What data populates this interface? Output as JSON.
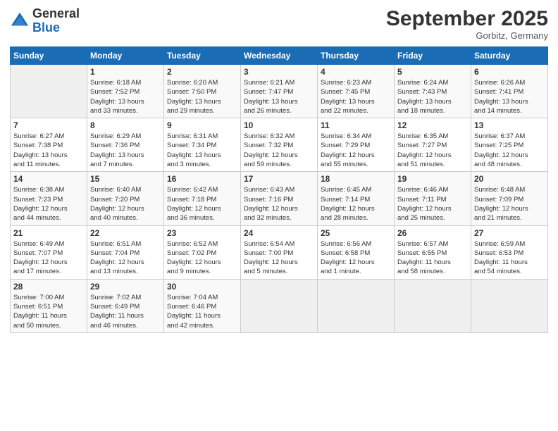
{
  "logo": {
    "general": "General",
    "blue": "Blue"
  },
  "title": "September 2025",
  "location": "Gorbitz, Germany",
  "weekdays": [
    "Sunday",
    "Monday",
    "Tuesday",
    "Wednesday",
    "Thursday",
    "Friday",
    "Saturday"
  ],
  "weeks": [
    [
      {
        "day": "",
        "info": ""
      },
      {
        "day": "1",
        "info": "Sunrise: 6:18 AM\nSunset: 7:52 PM\nDaylight: 13 hours\nand 33 minutes."
      },
      {
        "day": "2",
        "info": "Sunrise: 6:20 AM\nSunset: 7:50 PM\nDaylight: 13 hours\nand 29 minutes."
      },
      {
        "day": "3",
        "info": "Sunrise: 6:21 AM\nSunset: 7:47 PM\nDaylight: 13 hours\nand 26 minutes."
      },
      {
        "day": "4",
        "info": "Sunrise: 6:23 AM\nSunset: 7:45 PM\nDaylight: 13 hours\nand 22 minutes."
      },
      {
        "day": "5",
        "info": "Sunrise: 6:24 AM\nSunset: 7:43 PM\nDaylight: 13 hours\nand 18 minutes."
      },
      {
        "day": "6",
        "info": "Sunrise: 6:26 AM\nSunset: 7:41 PM\nDaylight: 13 hours\nand 14 minutes."
      }
    ],
    [
      {
        "day": "7",
        "info": "Sunrise: 6:27 AM\nSunset: 7:38 PM\nDaylight: 13 hours\nand 11 minutes."
      },
      {
        "day": "8",
        "info": "Sunrise: 6:29 AM\nSunset: 7:36 PM\nDaylight: 13 hours\nand 7 minutes."
      },
      {
        "day": "9",
        "info": "Sunrise: 6:31 AM\nSunset: 7:34 PM\nDaylight: 13 hours\nand 3 minutes."
      },
      {
        "day": "10",
        "info": "Sunrise: 6:32 AM\nSunset: 7:32 PM\nDaylight: 12 hours\nand 59 minutes."
      },
      {
        "day": "11",
        "info": "Sunrise: 6:34 AM\nSunset: 7:29 PM\nDaylight: 12 hours\nand 55 minutes."
      },
      {
        "day": "12",
        "info": "Sunrise: 6:35 AM\nSunset: 7:27 PM\nDaylight: 12 hours\nand 51 minutes."
      },
      {
        "day": "13",
        "info": "Sunrise: 6:37 AM\nSunset: 7:25 PM\nDaylight: 12 hours\nand 48 minutes."
      }
    ],
    [
      {
        "day": "14",
        "info": "Sunrise: 6:38 AM\nSunset: 7:23 PM\nDaylight: 12 hours\nand 44 minutes."
      },
      {
        "day": "15",
        "info": "Sunrise: 6:40 AM\nSunset: 7:20 PM\nDaylight: 12 hours\nand 40 minutes."
      },
      {
        "day": "16",
        "info": "Sunrise: 6:42 AM\nSunset: 7:18 PM\nDaylight: 12 hours\nand 36 minutes."
      },
      {
        "day": "17",
        "info": "Sunrise: 6:43 AM\nSunset: 7:16 PM\nDaylight: 12 hours\nand 32 minutes."
      },
      {
        "day": "18",
        "info": "Sunrise: 6:45 AM\nSunset: 7:14 PM\nDaylight: 12 hours\nand 28 minutes."
      },
      {
        "day": "19",
        "info": "Sunrise: 6:46 AM\nSunset: 7:11 PM\nDaylight: 12 hours\nand 25 minutes."
      },
      {
        "day": "20",
        "info": "Sunrise: 6:48 AM\nSunset: 7:09 PM\nDaylight: 12 hours\nand 21 minutes."
      }
    ],
    [
      {
        "day": "21",
        "info": "Sunrise: 6:49 AM\nSunset: 7:07 PM\nDaylight: 12 hours\nand 17 minutes."
      },
      {
        "day": "22",
        "info": "Sunrise: 6:51 AM\nSunset: 7:04 PM\nDaylight: 12 hours\nand 13 minutes."
      },
      {
        "day": "23",
        "info": "Sunrise: 6:52 AM\nSunset: 7:02 PM\nDaylight: 12 hours\nand 9 minutes."
      },
      {
        "day": "24",
        "info": "Sunrise: 6:54 AM\nSunset: 7:00 PM\nDaylight: 12 hours\nand 5 minutes."
      },
      {
        "day": "25",
        "info": "Sunrise: 6:56 AM\nSunset: 6:58 PM\nDaylight: 12 hours\nand 1 minute."
      },
      {
        "day": "26",
        "info": "Sunrise: 6:57 AM\nSunset: 6:55 PM\nDaylight: 11 hours\nand 58 minutes."
      },
      {
        "day": "27",
        "info": "Sunrise: 6:59 AM\nSunset: 6:53 PM\nDaylight: 11 hours\nand 54 minutes."
      }
    ],
    [
      {
        "day": "28",
        "info": "Sunrise: 7:00 AM\nSunset: 6:51 PM\nDaylight: 11 hours\nand 50 minutes."
      },
      {
        "day": "29",
        "info": "Sunrise: 7:02 AM\nSunset: 6:49 PM\nDaylight: 11 hours\nand 46 minutes."
      },
      {
        "day": "30",
        "info": "Sunrise: 7:04 AM\nSunset: 6:46 PM\nDaylight: 11 hours\nand 42 minutes."
      },
      {
        "day": "",
        "info": ""
      },
      {
        "day": "",
        "info": ""
      },
      {
        "day": "",
        "info": ""
      },
      {
        "day": "",
        "info": ""
      }
    ]
  ]
}
